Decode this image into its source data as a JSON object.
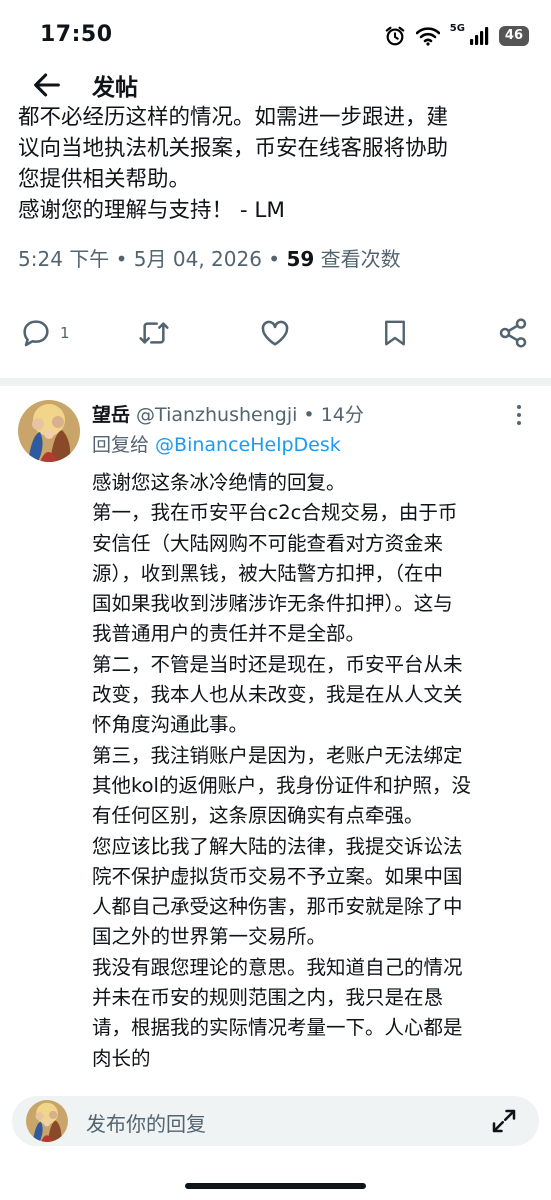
{
  "status_bar": {
    "time": "17:50",
    "network": "5G",
    "battery": "46"
  },
  "header": {
    "title": "发帖"
  },
  "tweet": {
    "text": "都不必经历这样的情况。如需进一步跟进，建\n议向当地执法机关报案，币安在线客服将协助\n您提供相关帮助。\n感谢您的理解与支持！ - LM",
    "time": "5:24 下午",
    "sep": " • ",
    "date": "5月 04, 2026",
    "views_count": "59",
    "views_label": " 查看次数",
    "reply_count": "1"
  },
  "reply": {
    "name": "望岳",
    "handle": " @Tianzhushengji",
    "sep": " • ",
    "time": "14分",
    "replying_prefix": "回复给 ",
    "replying_to": "@BinanceHelpDesk",
    "body": "感谢您这条冰冷绝情的回复。\n第一，我在币安平台c2c合规交易，由于币\n安信任（大陆网购不可能查看对方资金来\n源），收到黑钱，被大陆警方扣押，（在中\n国如果我收到涉赌涉诈无条件扣押）。这与\n我普通用户的责任并不是全部。\n第二，不管是当时还是现在，币安平台从未\n改变，我本人也从未改变，我是在从人文关\n怀角度沟通此事。\n第三，我注销账户是因为，老账户无法绑定\n其他kol的返佣账户，我身份证件和护照，没\n有任何区别，这条原因确实有点牵强。\n您应该比我了解大陆的法律，我提交诉讼法\n院不保护虚拟货币交易不予立案。如果中国\n人都自己承受这种伤害，那币安就是除了中\n国之外的世界第一交易所。\n我没有跟您理论的意思。我知道自己的情况\n并未在币安的规则范围之内，我只是在恳\n请，根据我的实际情况考量一下。人心都是\n肉长的"
  },
  "compose": {
    "placeholder": "发布你的回复"
  },
  "colors": {
    "text": "#0f1419",
    "secondary": "#536471",
    "link": "#1d9bf0",
    "divider": "#eff3f4"
  }
}
